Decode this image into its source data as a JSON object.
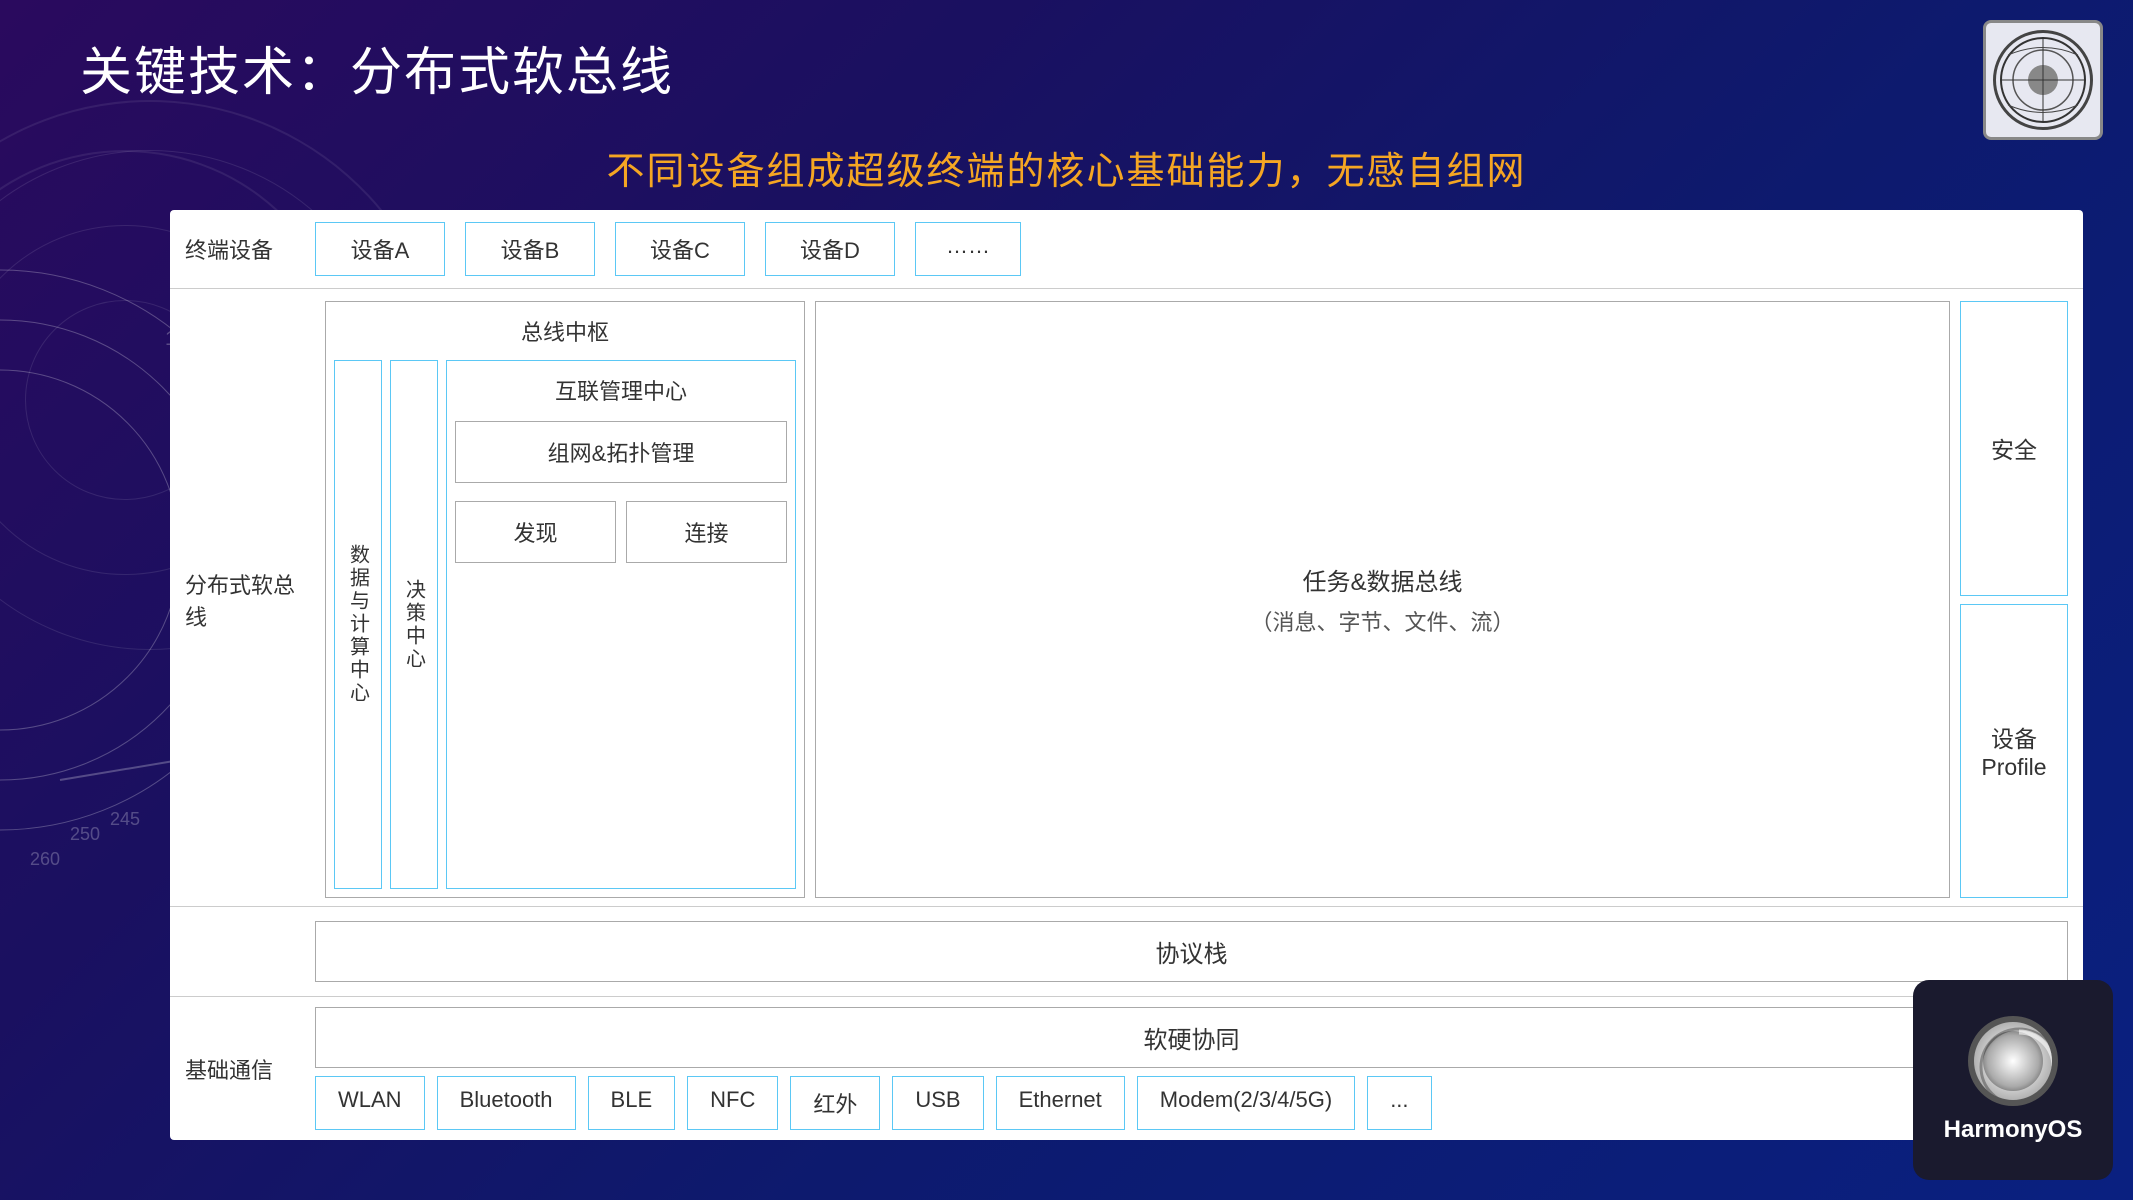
{
  "title": "关键技术：分布式软总线",
  "subtitle": "不同设备组成超级终端的核心基础能力，无感自组网",
  "devices_label": "终端设备",
  "softbus_label": "分布式软总线",
  "basic_comm_label": "基础通信",
  "devices": [
    "设备A",
    "设备B",
    "设备C",
    "设备D",
    "……"
  ],
  "bus_hub_title": "总线中枢",
  "data_center": "数据与计算中心",
  "decision_center": "决策中心",
  "interconnect_title": "互联管理中心",
  "topology_mgmt": "组网&拓扑管理",
  "discover": "发现",
  "connect": "连接",
  "task_data_bus_title": "任务&数据总线",
  "task_data_bus_subtitle": "（消息、字节、文件、流）",
  "security": "安全",
  "device_profile": "设备\nProfile",
  "protocol_stack": "协议栈",
  "soft_hard": "软硬协同",
  "tech_items": [
    "WLAN",
    "Bluetooth",
    "BLE",
    "NFC",
    "红外",
    "USB",
    "Ethernet",
    "Modem(2/3/4/5G)",
    "..."
  ],
  "harmonyos": "HarmonyOS"
}
